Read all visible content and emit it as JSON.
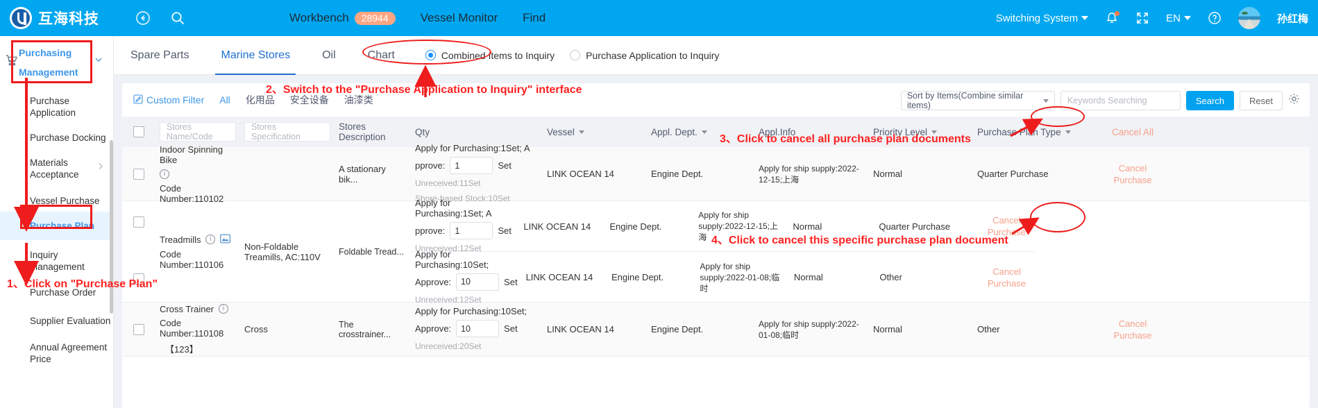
{
  "header": {
    "brand_name": "互海科技",
    "collapse_icon": "collapse-left-icon",
    "search_icon": "search-icon",
    "nav": [
      {
        "label": "Workbench",
        "badge": "28944"
      },
      {
        "label": "Vessel Monitor",
        "badge": ""
      },
      {
        "label": "Find",
        "badge": ""
      }
    ],
    "switch_system": "Switching System",
    "language": "EN",
    "user_name": "孙红梅"
  },
  "sidebar": {
    "title": "Purchasing Management",
    "items": [
      {
        "label": "Purchase Application",
        "active": false,
        "has_arrow": false
      },
      {
        "label": "Purchase Docking",
        "active": false,
        "has_arrow": false
      },
      {
        "label": "Materials Acceptance",
        "active": false,
        "has_arrow": true
      },
      {
        "label": "Vessel Purchase",
        "active": false,
        "has_arrow": false
      },
      {
        "label": "Purchase Plan",
        "active": true,
        "has_arrow": false
      },
      {
        "label": "Inquiry Management",
        "active": false,
        "has_arrow": false
      },
      {
        "label": "Purchase Order",
        "active": false,
        "has_arrow": false
      },
      {
        "label": "Supplier Evaluation",
        "active": false,
        "has_arrow": false
      },
      {
        "label": "Annual Agreement Price",
        "active": false,
        "has_arrow": false
      }
    ]
  },
  "tabs": [
    {
      "label": "Spare Parts",
      "active": false
    },
    {
      "label": "Marine Stores",
      "active": true
    },
    {
      "label": "Oil",
      "active": false
    },
    {
      "label": "Chart",
      "active": false
    }
  ],
  "radios": [
    {
      "label": "Combined Items to Inquiry",
      "selected": true
    },
    {
      "label": "Purchase Application to Inquiry",
      "selected": false
    }
  ],
  "filter": {
    "custom_filter": "Custom Filter",
    "quick": [
      "All",
      "化用品",
      "安全设备",
      "油漆类"
    ],
    "sort_value": "Sort by Items(Combine similar items)",
    "search_placeholder": "Keywords Searching",
    "search_button": "Search",
    "reset_button": "Reset",
    "settings_icon": "gear-icon"
  },
  "table": {
    "headers": {
      "name_placeholder": "Stores Name/Code",
      "spec_placeholder": "Stores Specification",
      "description": "Stores Description",
      "qty": "Qty",
      "vessel": "Vessel",
      "appl_dept": "Appl. Dept.",
      "appl_info": "Appl.Info",
      "priority": "Priority Level",
      "plan_type": "Purchase Plan Type",
      "cancel_all": "Cancel All"
    },
    "rows": [
      {
        "name": "Indoor Spinning Bike",
        "code": "Code Number:110102",
        "code_extra": "",
        "spec": "",
        "description": "A stationary bik...",
        "qty_line1": "Apply for Purchasing:1Set; A",
        "qty_label": "pprove:",
        "qty_value": "1",
        "qty_unit": "Set",
        "qty_notes": [
          "Unreceived:11Set",
          "Shore-based Stock:10Set"
        ],
        "vessel": "LINK OCEAN 14",
        "dept": "Engine Dept.",
        "appl_info": "Apply for ship supply:2022-12-15;上海",
        "priority": "Normal",
        "plan_type": "Quarter Purchase",
        "cancel": "Cancel Purchase",
        "has_image_icon": false,
        "alt": true
      },
      {
        "name": "Treadmills",
        "code": "Code Number:110106",
        "code_extra": "",
        "spec": "Non-Foldable Treamills, AC:110V",
        "description": "Foldable Tread...",
        "qty_line1": "Apply for Purchasing:1Set; A",
        "qty_label": "pprove:",
        "qty_value": "1",
        "qty_unit": "Set",
        "qty_notes": [
          "Unreceived:12Set"
        ],
        "vessel": "LINK OCEAN 14",
        "dept": "Engine Dept.",
        "appl_info": "Apply for ship supply:2022-12-15;上海",
        "priority": "Normal",
        "plan_type": "Quarter Purchase",
        "cancel": "Cancel Purchase",
        "has_image_icon": true,
        "alt": false
      },
      {
        "name": "",
        "code": "",
        "code_extra": "",
        "spec": "",
        "description": "",
        "qty_line1": "Apply for Purchasing:10Set;",
        "qty_label": "Approve:",
        "qty_value": "10",
        "qty_unit": "Set",
        "qty_notes": [
          "Unreceived:12Set"
        ],
        "vessel": "LINK OCEAN 14",
        "dept": "Engine Dept.",
        "appl_info": "Apply for ship supply:2022-01-08;临时",
        "priority": "Normal",
        "plan_type": "Other",
        "cancel": "Cancel Purchase",
        "has_image_icon": false,
        "alt": false
      },
      {
        "name": "Cross Trainer",
        "code": "Code Number:110108",
        "code_extra": "【123】",
        "spec": "Cross",
        "description": "The crosstrainer...",
        "qty_line1": "Apply for Purchasing:10Set;",
        "qty_label": "Approve:",
        "qty_value": "10",
        "qty_unit": "Set",
        "qty_notes": [
          "Unreceived:20Set"
        ],
        "vessel": "LINK OCEAN 14",
        "dept": "Engine Dept.",
        "appl_info": "Apply for ship supply:2022-01-08;临时",
        "priority": "Normal",
        "plan_type": "Other",
        "cancel": "Cancel Purchase",
        "has_image_icon": false,
        "alt": true
      }
    ]
  },
  "annotations": [
    {
      "id": "a1",
      "text": "1、Click on \"Purchase Plan\""
    },
    {
      "id": "a2",
      "text": "2、Switch to the \"Purchase Application to Inquiry\" interface"
    },
    {
      "id": "a3",
      "text": "3、Click to cancel all purchase plan documents"
    },
    {
      "id": "a4",
      "text": "4、Click to cancel this specific purchase plan document"
    }
  ],
  "colors": {
    "brand_blue": "#00a7f0",
    "accent_blue": "#3d96e8",
    "annotation_red": "#ff2020",
    "cancel_orange": "#f7a08a",
    "badge_orange": "#ffa683"
  }
}
